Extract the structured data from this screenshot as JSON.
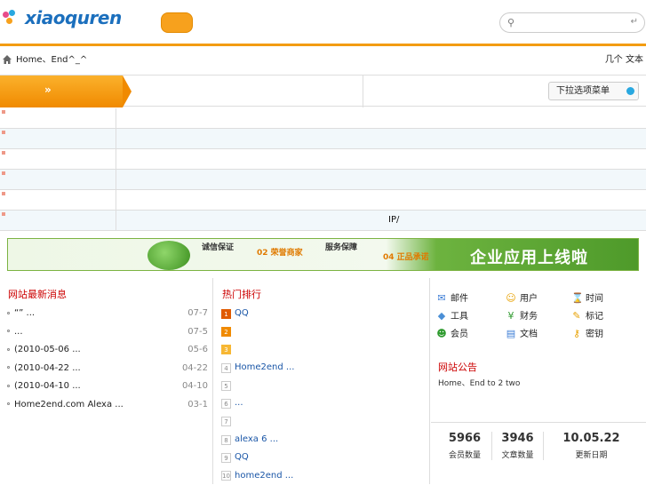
{
  "header": {
    "logo_text": "xiaoquren",
    "search": {
      "placeholder": "",
      "go_icon": "enter-icon"
    },
    "accent": "#f39c12"
  },
  "notice": {
    "message": "Home、End^_^",
    "right_links": "几个 文本"
  },
  "nav": {
    "tab_arrow": "»",
    "select_label": "下拉选项菜单"
  },
  "grid": {
    "rows": [
      {
        "cells": [
          "",
          "",
          "",
          ""
        ]
      },
      {
        "cells": [
          "",
          "",
          "",
          ""
        ]
      },
      {
        "cells": [
          "",
          "",
          "",
          ""
        ]
      },
      {
        "cells": [
          "",
          "",
          "",
          ""
        ]
      },
      {
        "cells": [
          "",
          "",
          "",
          ""
        ]
      },
      {
        "cells": [
          "",
          "",
          "IP/",
          ""
        ]
      }
    ]
  },
  "banner": {
    "b1": "诚信保证",
    "b2": "02 荣誉商家",
    "b3": "服务保障",
    "b4": "04 正品承诺",
    "headline": "企业应用上线啦"
  },
  "news": {
    "title": "网站最新消息",
    "items": [
      {
        "text": "“” ...",
        "date": "07-7"
      },
      {
        "text": "...",
        "date": "07-5"
      },
      {
        "text": "(2010-05-06 ...",
        "date": "05-6"
      },
      {
        "text": "(2010-04-22 ...",
        "date": "04-22"
      },
      {
        "text": "(2010-04-10 ...",
        "date": "04-10"
      },
      {
        "text": "Home2end.com Alexa ...",
        "date": "03-1"
      }
    ]
  },
  "ranking": {
    "title": "热门排行",
    "items": [
      {
        "n": "1",
        "text": "QQ"
      },
      {
        "n": "2",
        "text": ""
      },
      {
        "n": "3",
        "text": ""
      },
      {
        "n": "4",
        "text": "Home2end ..."
      },
      {
        "n": "5",
        "text": ""
      },
      {
        "n": "6",
        "text": "..."
      },
      {
        "n": "7",
        "text": ""
      },
      {
        "n": "8",
        "text": "alexa 6 ..."
      },
      {
        "n": "9",
        "text": "QQ"
      },
      {
        "n": "10",
        "text": "home2end ..."
      }
    ]
  },
  "tools": [
    {
      "icon": "envelope-icon",
      "glyph": "✉",
      "label": "邮件"
    },
    {
      "icon": "user-icon",
      "glyph": "☺",
      "label": "用户"
    },
    {
      "icon": "hourglass-icon",
      "glyph": "⌛",
      "label": "时间"
    },
    {
      "icon": "bucket-icon",
      "glyph": "◆",
      "label": "工具"
    },
    {
      "icon": "yen-icon",
      "glyph": "¥",
      "label": "财务"
    },
    {
      "icon": "pin-icon",
      "glyph": "✎",
      "label": "标记"
    },
    {
      "icon": "users-icon",
      "glyph": "☻",
      "label": "会员"
    },
    {
      "icon": "document-icon",
      "glyph": "▤",
      "label": "文档"
    },
    {
      "icon": "key-icon",
      "glyph": "⚷",
      "label": "密钥"
    }
  ],
  "announcement": {
    "title": "网站公告",
    "text": "Home、End to 2 two"
  },
  "stats": [
    {
      "value": "5966",
      "label": "会员数量"
    },
    {
      "value": "3946",
      "label": "文章数量"
    },
    {
      "value": "10.05.22",
      "label": "更新日期"
    }
  ]
}
